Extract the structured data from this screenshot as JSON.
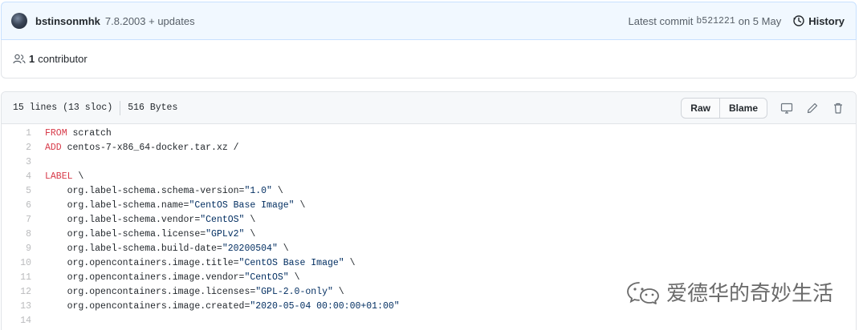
{
  "commit": {
    "author": "bstinsonmhk",
    "message": "7.8.2003 + updates",
    "latest_label": "Latest commit",
    "sha": "b521221",
    "date": "on 5 May",
    "history_label": "History"
  },
  "contributors": {
    "count": "1",
    "label": "contributor"
  },
  "file": {
    "lines_info": "15 lines (13 sloc)",
    "size": "516 Bytes",
    "raw_label": "Raw",
    "blame_label": "Blame"
  },
  "code": [
    {
      "num": "1",
      "kw": "FROM",
      "rest": " scratch",
      "str": "",
      "tail": ""
    },
    {
      "num": "2",
      "kw": "ADD",
      "rest": " centos-7-x86_64-docker.tar.xz /",
      "str": "",
      "tail": ""
    },
    {
      "num": "3",
      "kw": "",
      "rest": "",
      "str": "",
      "tail": ""
    },
    {
      "num": "4",
      "kw": "LABEL",
      "rest": " \\",
      "str": "",
      "tail": ""
    },
    {
      "num": "5",
      "kw": "",
      "rest": "    org.label-schema.schema-version=",
      "str": "\"1.0\"",
      "tail": " \\"
    },
    {
      "num": "6",
      "kw": "",
      "rest": "    org.label-schema.name=",
      "str": "\"CentOS Base Image\"",
      "tail": " \\"
    },
    {
      "num": "7",
      "kw": "",
      "rest": "    org.label-schema.vendor=",
      "str": "\"CentOS\"",
      "tail": " \\"
    },
    {
      "num": "8",
      "kw": "",
      "rest": "    org.label-schema.license=",
      "str": "\"GPLv2\"",
      "tail": " \\"
    },
    {
      "num": "9",
      "kw": "",
      "rest": "    org.label-schema.build-date=",
      "str": "\"20200504\"",
      "tail": " \\"
    },
    {
      "num": "10",
      "kw": "",
      "rest": "    org.opencontainers.image.title=",
      "str": "\"CentOS Base Image\"",
      "tail": " \\"
    },
    {
      "num": "11",
      "kw": "",
      "rest": "    org.opencontainers.image.vendor=",
      "str": "\"CentOS\"",
      "tail": " \\"
    },
    {
      "num": "12",
      "kw": "",
      "rest": "    org.opencontainers.image.licenses=",
      "str": "\"GPL-2.0-only\"",
      "tail": " \\"
    },
    {
      "num": "13",
      "kw": "",
      "rest": "    org.opencontainers.image.created=",
      "str": "\"2020-05-04 00:00:00+01:00\"",
      "tail": ""
    },
    {
      "num": "14",
      "kw": "",
      "rest": "",
      "str": "",
      "tail": ""
    }
  ],
  "watermark": {
    "text": "爱德华的奇妙生活",
    "icon": "wechat-icon"
  },
  "colors": {
    "keyword": "#d73a49",
    "string": "#032f62",
    "commit_bg": "#f1f8ff"
  }
}
